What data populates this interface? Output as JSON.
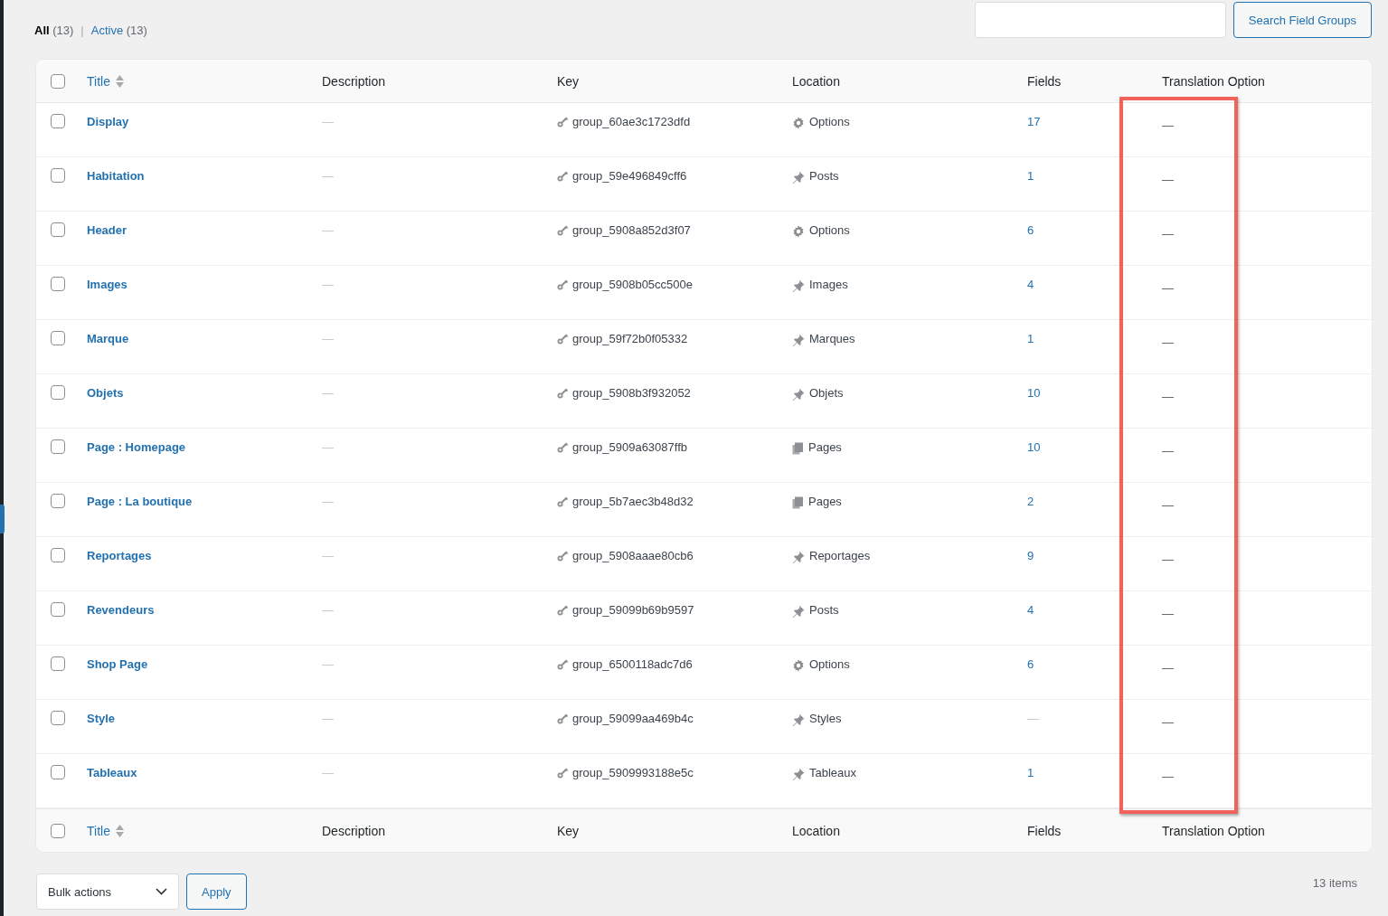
{
  "filters": [
    {
      "label": "All",
      "count": "(13)",
      "selected": true
    },
    {
      "label": "Active",
      "count": "(13)",
      "selected": false
    }
  ],
  "filter_separator": "|",
  "search": {
    "button": "Search Field Groups"
  },
  "table": {
    "columns": [
      {
        "label": "Title",
        "sortable": true
      },
      {
        "label": "Description",
        "sortable": false
      },
      {
        "label": "Key",
        "sortable": false
      },
      {
        "label": "Location",
        "sortable": false
      },
      {
        "label": "Fields",
        "sortable": false
      },
      {
        "label": "Translation Option",
        "sortable": false
      }
    ],
    "header_checked": false,
    "rows": [
      {
        "title": "Display",
        "description": "—",
        "key": "group_60ae3c1723dfd",
        "kind": "gear",
        "location": "Options",
        "fields": "17",
        "translation": "—",
        "checked": false
      },
      {
        "title": "Habitation",
        "description": "—",
        "key": "group_59e496849cff6",
        "kind": "pin",
        "location": "Posts",
        "fields": "1",
        "translation": "—",
        "checked": false
      },
      {
        "title": "Header",
        "description": "—",
        "key": "group_5908a852d3f07",
        "kind": "gear",
        "location": "Options",
        "fields": "6",
        "translation": "—",
        "checked": false
      },
      {
        "title": "Images",
        "description": "—",
        "key": "group_5908b05cc500e",
        "kind": "pin",
        "location": "Images",
        "fields": "4",
        "translation": "—",
        "checked": false
      },
      {
        "title": "Marque",
        "description": "—",
        "key": "group_59f72b0f05332",
        "kind": "pin",
        "location": "Marques",
        "fields": "1",
        "translation": "—",
        "checked": false
      },
      {
        "title": "Objets",
        "description": "—",
        "key": "group_5908b3f932052",
        "kind": "pin",
        "location": "Objets",
        "fields": "10",
        "translation": "—",
        "checked": false
      },
      {
        "title": "Page : Homepage",
        "description": "—",
        "key": "group_5909a63087ffb",
        "kind": "pages",
        "location": "Pages",
        "fields": "10",
        "translation": "—",
        "checked": false
      },
      {
        "title": "Page : La boutique",
        "description": "—",
        "key": "group_5b7aec3b48d32",
        "kind": "pages",
        "location": "Pages",
        "fields": "2",
        "translation": "—",
        "checked": false
      },
      {
        "title": "Reportages",
        "description": "—",
        "key": "group_5908aaae80cb6",
        "kind": "pin",
        "location": "Reportages",
        "fields": "9",
        "translation": "—",
        "checked": false
      },
      {
        "title": "Revendeurs",
        "description": "—",
        "key": "group_59099b69b9597",
        "kind": "pin",
        "location": "Posts",
        "fields": "4",
        "translation": "—",
        "checked": false
      },
      {
        "title": "Shop Page",
        "description": "—",
        "key": "group_6500118adc7d6",
        "kind": "gear",
        "location": "Options",
        "fields": "6",
        "translation": "—",
        "checked": false
      },
      {
        "title": "Style",
        "description": "—",
        "key": "group_59099aa469b4c",
        "kind": "pin",
        "location": "Styles",
        "fields": "—",
        "translation": "—",
        "checked": false
      },
      {
        "title": "Tableaux",
        "description": "—",
        "key": "group_5909993188e5c",
        "kind": "pin",
        "location": "Tableaux",
        "fields": "1",
        "translation": "—",
        "checked": false
      }
    ],
    "footer_columns": [
      {
        "label": "Title",
        "sortable": true
      },
      {
        "label": "Description",
        "sortable": false
      },
      {
        "label": "Key",
        "sortable": false
      },
      {
        "label": "Location",
        "sortable": false
      },
      {
        "label": "Fields",
        "sortable": false
      },
      {
        "label": "Translation Option",
        "sortable": false
      }
    ],
    "footer_checked": false
  },
  "bulk_actions": {
    "value": "Bulk actions",
    "button": "Apply"
  },
  "item_count": "13 items"
}
